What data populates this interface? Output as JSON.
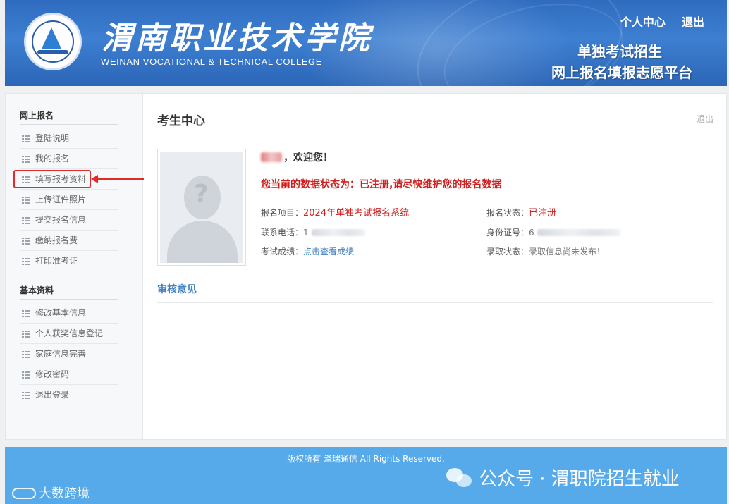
{
  "header": {
    "college_cn": "渭南职业技术学院",
    "college_en": "WEINAN VOCATIONAL & TECHNICAL COLLEGE",
    "links": [
      "个人中心",
      "退出"
    ],
    "system_title_line1": "单独考试招生",
    "system_title_line2": "网上报名填报志愿平台"
  },
  "sidebar": {
    "group1_title": "网上报名",
    "group1_items": [
      "登陆说明",
      "我的报名",
      "填写报考资料",
      "上传证件照片",
      "提交报名信息",
      "缴纳报名费",
      "打印准考证"
    ],
    "group2_title": "基本资料",
    "group2_items": [
      "修改基本信息",
      "个人获奖信息登记",
      "家庭信息完善",
      "修改密码",
      "退出登录"
    ],
    "highlighted_item": "填写报考资料"
  },
  "content": {
    "page_title": "考生中心",
    "logout_label": "退出",
    "welcome_suffix": "，欢迎您！",
    "status_message": "您当前的数据状态为：已注册,请尽快维护您的报名数据",
    "info": {
      "project_label": "报名项目：",
      "project_value": "2024年单独考试报名系统",
      "reg_status_label": "报名状态：",
      "reg_status_value": "已注册",
      "phone_label": "联系电话：",
      "phone_value": "1",
      "id_label": "身份证号：",
      "id_value": "6",
      "score_label": "考试成绩：",
      "score_value": "点击查看成绩",
      "admission_label": "录取状态：",
      "admission_value": "录取信息尚未发布！"
    },
    "review_title": "审核意见"
  },
  "footer": {
    "copyright": "版权所有 泽瑞通信 All Rights Reserved.",
    "wechat_text": "公众号 · 渭职院招生就业",
    "watermark_text": "大数跨境"
  },
  "colors": {
    "header_blue": "#3d7fd1",
    "footer_blue": "#56aae9",
    "status_red": "#d01f1f",
    "link_blue": "#3f7fc4"
  }
}
